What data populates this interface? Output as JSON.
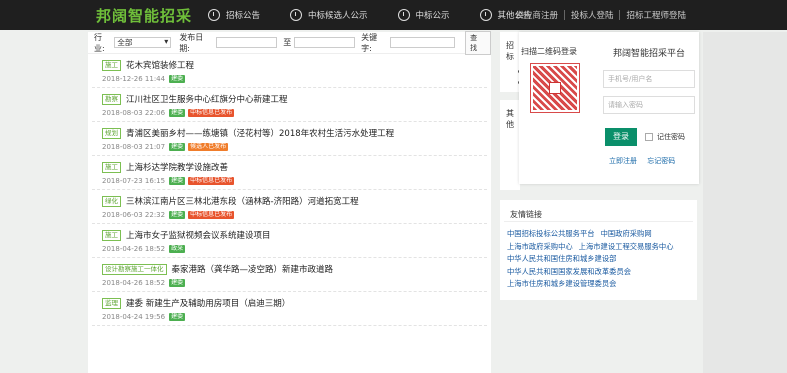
{
  "header": {
    "logo": "邦阔智能招采",
    "nav": [
      {
        "label": "招标公告",
        "icon": "bid-announcement-icon"
      },
      {
        "label": "中标候选人公示",
        "icon": "clock-icon"
      },
      {
        "label": "中标公示",
        "icon": "eye-icon"
      },
      {
        "label": "其他公告",
        "icon": "gauge-icon"
      }
    ],
    "right_links": [
      "供应商注册",
      "投标人登陆",
      "招标工程师登陆"
    ]
  },
  "filter": {
    "industry_label": "行业:",
    "industry_value": "全部",
    "date_label": "发布日期:",
    "to_label": "至",
    "keyword_label": "关键字:",
    "search_button": "查 找"
  },
  "list": [
    {
      "tag": "施工",
      "title": "花木宾馆装修工程",
      "date": "2018-12-26 11:44",
      "badges": [
        {
          "text": "建委",
          "color": "green"
        }
      ]
    },
    {
      "tag": "勘察",
      "title": "江川社区卫生服务中心红旗分中心新建工程",
      "date": "2018-08-03 22:06",
      "badges": [
        {
          "text": "建委",
          "color": "green"
        },
        {
          "text": "中标信息已发布",
          "color": "red"
        }
      ]
    },
    {
      "tag": "规划",
      "title": "青浦区美丽乡村——练塘镇（泾花村等）2018年农村生活污水处理工程",
      "date": "2018-08-03 21:07",
      "badges": [
        {
          "text": "建委",
          "color": "green"
        },
        {
          "text": "候选人已发布",
          "color": "orange"
        }
      ]
    },
    {
      "tag": "施工",
      "title": "上海杉达学院教学设施改善",
      "date": "2018-07-23 16:15",
      "badges": [
        {
          "text": "建委",
          "color": "green"
        },
        {
          "text": "中标信息已发布",
          "color": "red"
        }
      ]
    },
    {
      "tag": "绿化",
      "title": "三林滨江南片区三林北港东段（涵林路-济阳路）河道拓宽工程",
      "date": "2018-06-03 22:32",
      "badges": [
        {
          "text": "建委",
          "color": "green"
        },
        {
          "text": "中标信息已发布",
          "color": "red"
        }
      ]
    },
    {
      "tag": "施工",
      "title": "上海市女子监狱视频会议系统建设项目",
      "date": "2018-04-26 18:52",
      "badges": [
        {
          "text": "政采",
          "color": "green"
        }
      ]
    },
    {
      "tag": "设计勘察施工一体化",
      "title": "秦家港路（龚华路—凌空路）新建市政道路",
      "date": "2018-04-26 18:52",
      "badges": [
        {
          "text": "建委",
          "color": "green"
        }
      ]
    },
    {
      "tag": "监理",
      "title": "建委 新建生产及辅助用房项目（启迪三期）",
      "date": "2018-04-24 19:56",
      "badges": [
        {
          "text": "建委",
          "color": "green"
        }
      ]
    }
  ],
  "side": {
    "box1_head": "招标",
    "box2_head": "其他"
  },
  "login": {
    "qr_title": "扫描二维码登录",
    "title": "邦阔智能招采平台",
    "phone_placeholder": "手机号/用户名",
    "password_placeholder": "请输入密码",
    "login_button": "登录",
    "remember": "记住密码",
    "register": "立即注册",
    "forgot": "忘记密码"
  },
  "friends": {
    "head": "友情链接",
    "links": [
      [
        "中国招标投标公共服务平台",
        "中国政府采购网"
      ],
      [
        "上海市政府采购中心",
        "上海市建设工程交易服务中心"
      ],
      [
        "中华人民共和国住房和城乡建设部"
      ],
      [
        "中华人民共和国国家发展和改革委员会"
      ],
      [
        "上海市住房和城乡建设管理委员会"
      ]
    ]
  }
}
